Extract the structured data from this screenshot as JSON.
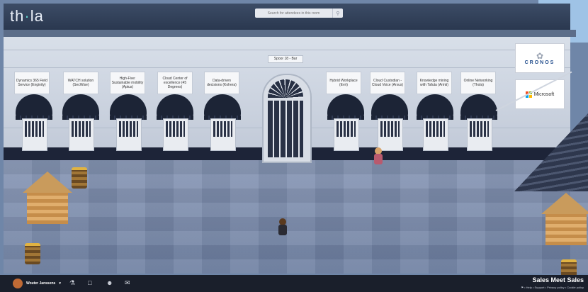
{
  "app": {
    "logo": "th",
    "logo_dot": "·",
    "logo_tail": "la"
  },
  "search": {
    "placeholder": "Search for attendees in this room",
    "button_icon": "search-icon"
  },
  "room": {
    "bar_sign": "Spoor 18 - Bar"
  },
  "booths": [
    {
      "label": "Dynamics 365 Field Service (Enginity)"
    },
    {
      "label": "WATCH solution (SecWise)"
    },
    {
      "label": "High-Five: Sustainable mobility (Aptus)"
    },
    {
      "label": "Cloud Center of excellence (45 Degrees)"
    },
    {
      "label": "Data-driven decisions (Kohera)"
    },
    {
      "label": "Hybrid Workplace (Evri)"
    },
    {
      "label": "Cloud Custodian - Cloud Voice (Arxus)"
    },
    {
      "label": "Knowledge mining with Tafuta (Arinti)"
    },
    {
      "label": "Online Networking (Thola)"
    }
  ],
  "sponsors": [
    {
      "name": "CRONOS",
      "icon": "cronos-logo-icon"
    },
    {
      "name": "Microsoft",
      "icon": "microsoft-logo-icon"
    }
  ],
  "toolbar": {
    "user_name": "Wouter Janssens",
    "user_suffix": "▾",
    "icons": [
      "accessibility-icon",
      "bookmark-icon",
      "group-icon",
      "chat-icon"
    ]
  },
  "footer": {
    "brand": "Sales Meet Sales",
    "links": "⚑ • Help • Support • Privacy policy • Cookie policy"
  },
  "colors": {
    "toolbar_bg": "#1a1f2b",
    "accent": "#5fd0c8",
    "floor": "#7385a6"
  }
}
